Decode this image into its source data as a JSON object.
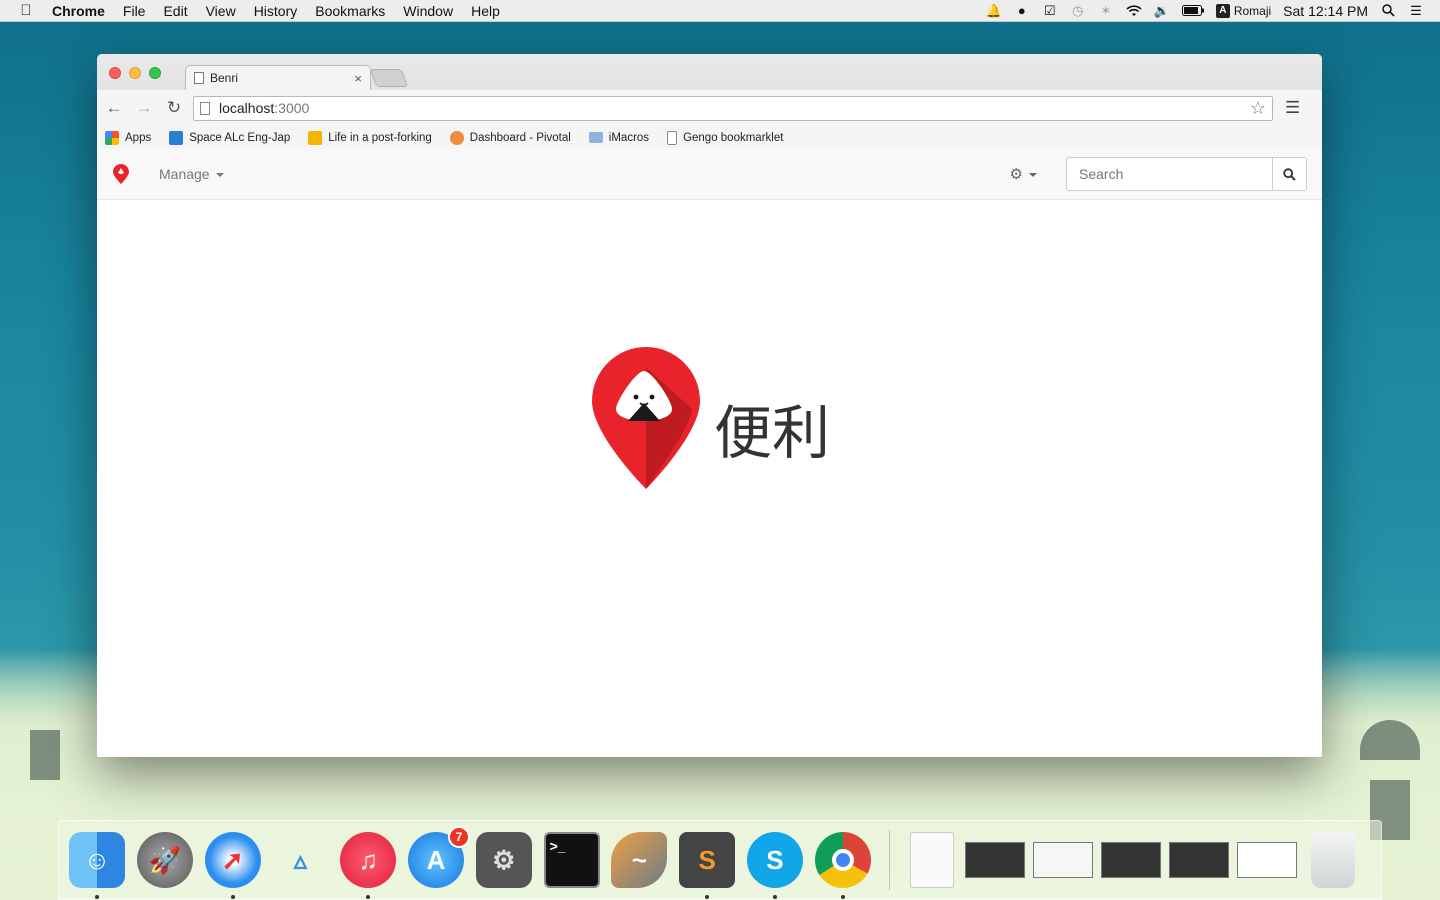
{
  "menubar": {
    "app_name": "Chrome",
    "items": [
      "File",
      "Edit",
      "View",
      "History",
      "Bookmarks",
      "Window",
      "Help"
    ],
    "input_method": "Romaji",
    "clock": "Sat 12:14 PM"
  },
  "browser": {
    "tab_title": "Benri",
    "url_host": "localhost",
    "url_port": ":3000",
    "bookmarks": [
      "Apps",
      "Space ALc Eng-Jap",
      "Life in a post-forking",
      "Dashboard - Pivotal",
      "iMacros",
      "Gengo bookmarklet"
    ]
  },
  "navbar": {
    "manage_label": "Manage",
    "search_placeholder": "Search"
  },
  "hero": {
    "title": "便利"
  },
  "dock": {
    "appstore_badge": "7"
  },
  "colors": {
    "brand_red": "#e8232b",
    "brand_dark_red": "#b81a20"
  }
}
